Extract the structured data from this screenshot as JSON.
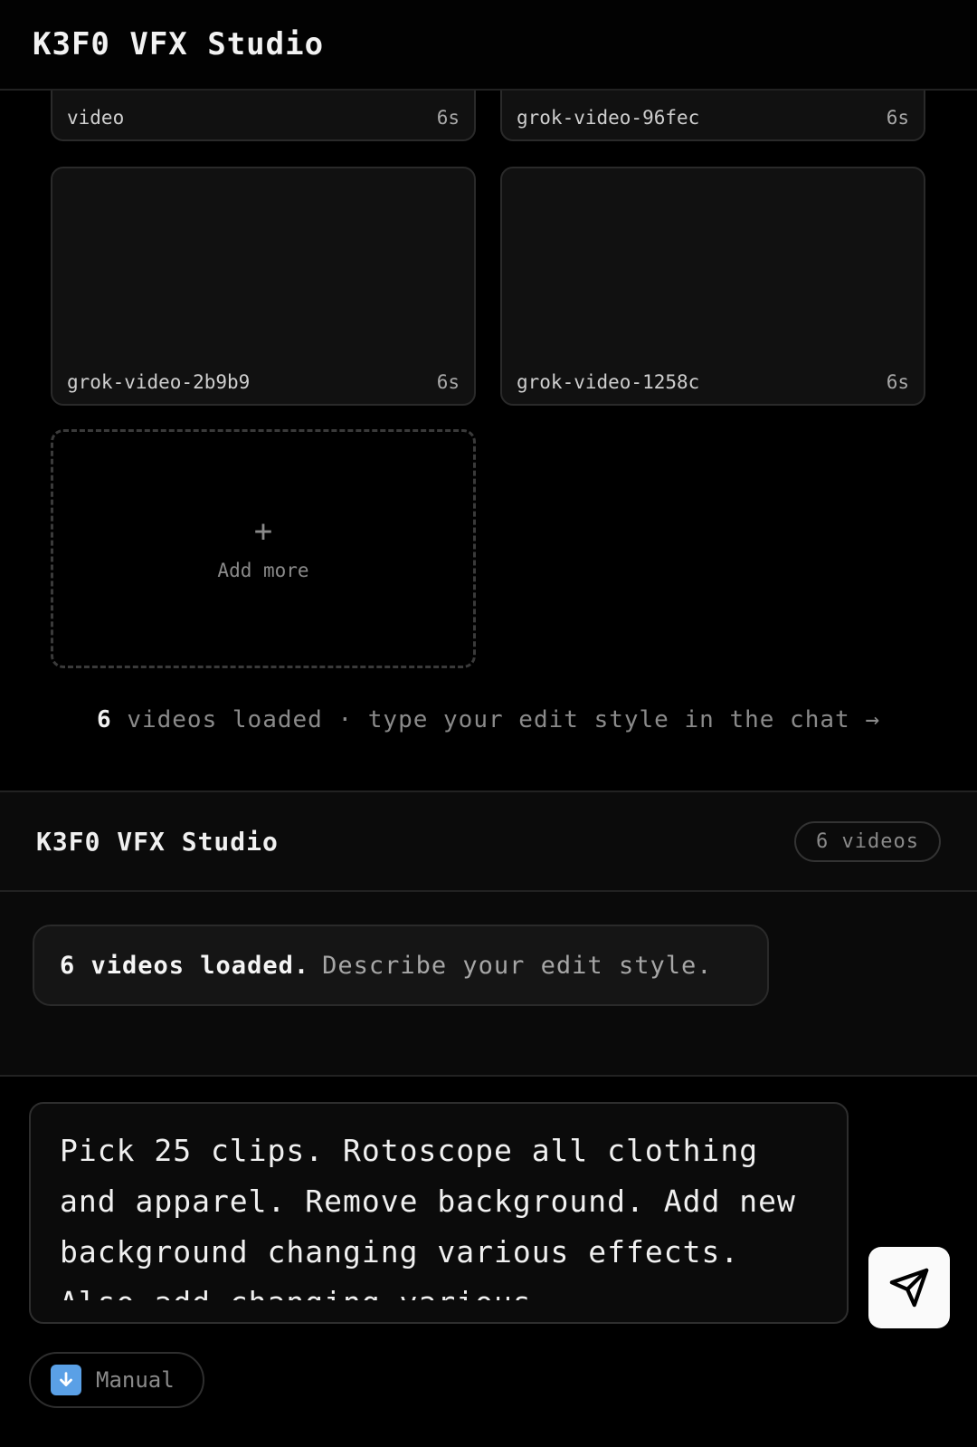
{
  "header": {
    "title": "K3F0 VFX Studio"
  },
  "videos": [
    {
      "name": "video",
      "duration": "6s"
    },
    {
      "name": "grok-video-96fec",
      "duration": "6s"
    },
    {
      "name": "grok-video-2b9b9",
      "duration": "6s"
    },
    {
      "name": "grok-video-1258c",
      "duration": "6s"
    }
  ],
  "add_more": {
    "plus": "+",
    "label": "Add more"
  },
  "status": {
    "count": "6",
    "text": "videos loaded · type your edit style in the chat →"
  },
  "chat": {
    "title": "K3F0 VFX Studio",
    "badge": "6 videos",
    "message": {
      "strong": "6 videos loaded.",
      "rest": "Describe your edit style."
    }
  },
  "composer": {
    "value": "Pick 25 clips. Rotoscope all clothing and apparel. Remove background. Add new background changing various effects. Also add changing various",
    "send_icon": "send-icon",
    "manual_label": "Manual",
    "manual_icon": "download-arrow-icon"
  },
  "colors": {
    "background": "#000000",
    "card": "#111111",
    "send_button": "#fafafa",
    "manual_icon": "#5aa0e6"
  }
}
